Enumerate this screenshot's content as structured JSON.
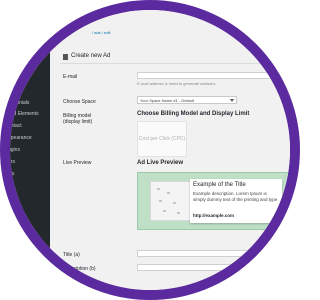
{
  "breadcrumb": {
    "text": "/ ads / edit"
  },
  "page": {
    "title": "Create new Ad"
  },
  "sidebar": {
    "items": [
      {
        "label": "tto"
      },
      {
        "label": "ts"
      },
      {
        "label": "rtimonials"
      },
      {
        "label": "ried Elements"
      },
      {
        "label": "ontact"
      },
      {
        "label": "ppearance"
      },
      {
        "label": "ugins"
      },
      {
        "label": "ers"
      },
      {
        "label": "ols"
      }
    ]
  },
  "form": {
    "email": {
      "label": "E-mail",
      "help": "E-mail address is need to generate statistics."
    },
    "space": {
      "label": "Choose Space",
      "value": "Your Space Name #1 - Default"
    },
    "billing": {
      "label": "Billing model (display limit)",
      "heading": "Choose Billing Model and Display Limit",
      "cpc": "Cost per Click (CPC)"
    },
    "live_preview": {
      "label": "Live Preview",
      "heading": "Ad Live Preview"
    },
    "title_field": {
      "label": "Title (a)"
    },
    "desc_field": {
      "label": "Description (b)"
    }
  },
  "preview_ad": {
    "title": "Example of the Title",
    "description": "Example description. Lorem Ipsum is simply dummy text of the printing and type",
    "url": "http://example.com"
  },
  "colors": {
    "ring": "#5b2a9e",
    "sidebar": "#23282d",
    "preview_bg": "#bfe0c7",
    "link": "#0073aa"
  }
}
